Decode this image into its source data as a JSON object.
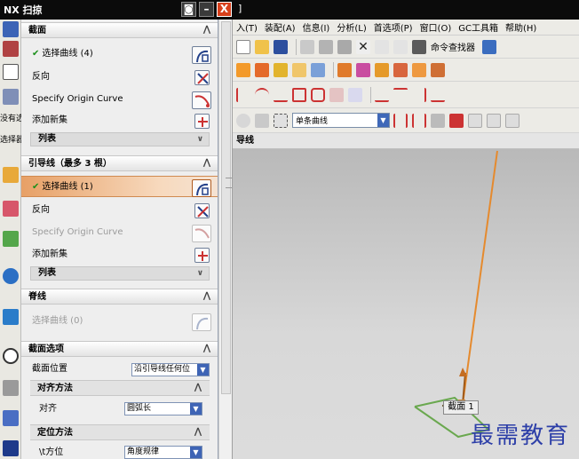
{
  "app": {
    "title_left": "NX 扫掠",
    "title_right": "]"
  },
  "window_buttons": {
    "restore": "◙",
    "minimize": "–",
    "close": "X"
  },
  "menu": [
    "入(T)",
    "装配(A)",
    "信息(I)",
    "分析(L)",
    "首选项(P)",
    "窗口(O)",
    "GC工具箱",
    "帮助(H)"
  ],
  "toolbar": {
    "command_finder": "命令查找器",
    "selection_filter": "单条曲线",
    "subheading": "导线"
  },
  "left_strip": {
    "label_a": "没有选",
    "label_b": "选择器"
  },
  "dialog": {
    "section_profile": {
      "title": "截面",
      "select_curve": "选择曲线 (4)",
      "reverse": "反向",
      "origin_curve": "Specify Origin Curve",
      "add_new_set": "添加新集",
      "list": "列表"
    },
    "section_guides": {
      "title": "引导线（最多 3 根）",
      "select_curve": "选择曲线 (1)",
      "reverse": "反向",
      "origin_curve": "Specify Origin Curve",
      "add_new_set": "添加新集",
      "list": "列表"
    },
    "section_spine": {
      "title": "脊线",
      "select_curve": "选择曲线 (0)"
    },
    "section_options": {
      "title": "截面选项",
      "position_label": "截面位置",
      "position_value": "沿引导线任何位",
      "alignment": {
        "title": "对齐方法",
        "label": "对齐",
        "value": "圆弧长"
      },
      "orientation": {
        "title": "定位方法",
        "label": "\\t方位",
        "value": "角度规律"
      }
    }
  },
  "viewport": {
    "section_label": "截面 1"
  },
  "watermark": "最需教育",
  "colors": {
    "accent_orange": "#e58a2e",
    "highlight_row": "#e7a066",
    "viewport_top": "#b9b9b9",
    "curve_green": "#6aa84f",
    "watermark_blue": "#2d3fa8"
  }
}
